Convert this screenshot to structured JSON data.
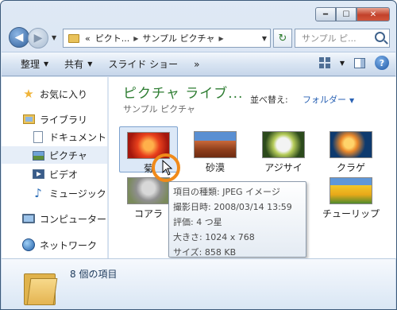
{
  "window": {
    "caption": {
      "minimize": "━",
      "maximize": "☐",
      "close": "✕"
    }
  },
  "nav": {
    "back_icon": "back-arrow",
    "forward_icon": "forward-arrow",
    "address": {
      "prefix": "«",
      "segments": [
        "ピクト...",
        "サンプル ピクチャ"
      ],
      "seg1": "ピクト",
      "seg2": "サンプル ピクチャ"
    },
    "search_placeholder": "サンプル ピ..."
  },
  "toolbar": {
    "organize": "整理",
    "share": "共有",
    "slideshow": "スライド ショー",
    "more": "»"
  },
  "sidebar": {
    "favorites": "お気に入り",
    "libraries": "ライブラリ",
    "documents": "ドキュメント",
    "pictures": "ピクチャ",
    "videos": "ビデオ",
    "music": "ミュージック",
    "computer": "コンピューター",
    "network": "ネットワーク"
  },
  "content": {
    "library_title": "ピクチャ ライブ...",
    "library_subtitle": "サンプル ピクチャ",
    "arrange_label": "並べ替え:",
    "arrange_value": "フォルダー",
    "items": [
      {
        "label": "菊",
        "thumb": "chrysanthemum"
      },
      {
        "label": "砂漠",
        "thumb": "desert"
      },
      {
        "label": "アジサイ",
        "thumb": "hydrangea"
      },
      {
        "label": "クラゲ",
        "thumb": "jellyfish"
      },
      {
        "label": "コアラ",
        "thumb": "koala"
      },
      {
        "label": "チューリップ",
        "thumb": "tulips"
      }
    ]
  },
  "tooltip": {
    "type": "項目の種類: JPEG イメージ",
    "date": "撮影日時: 2008/03/14 13:59",
    "rating": "評価: 4 つ星",
    "dimensions": "大きさ: 1024 x 768",
    "size": "サイズ: 858 KB"
  },
  "details": {
    "count": "8 個の項目"
  },
  "colors": {
    "library_title": "#2e7d32",
    "link": "#2a62b4",
    "cursor_highlight": "#f08a1a"
  }
}
